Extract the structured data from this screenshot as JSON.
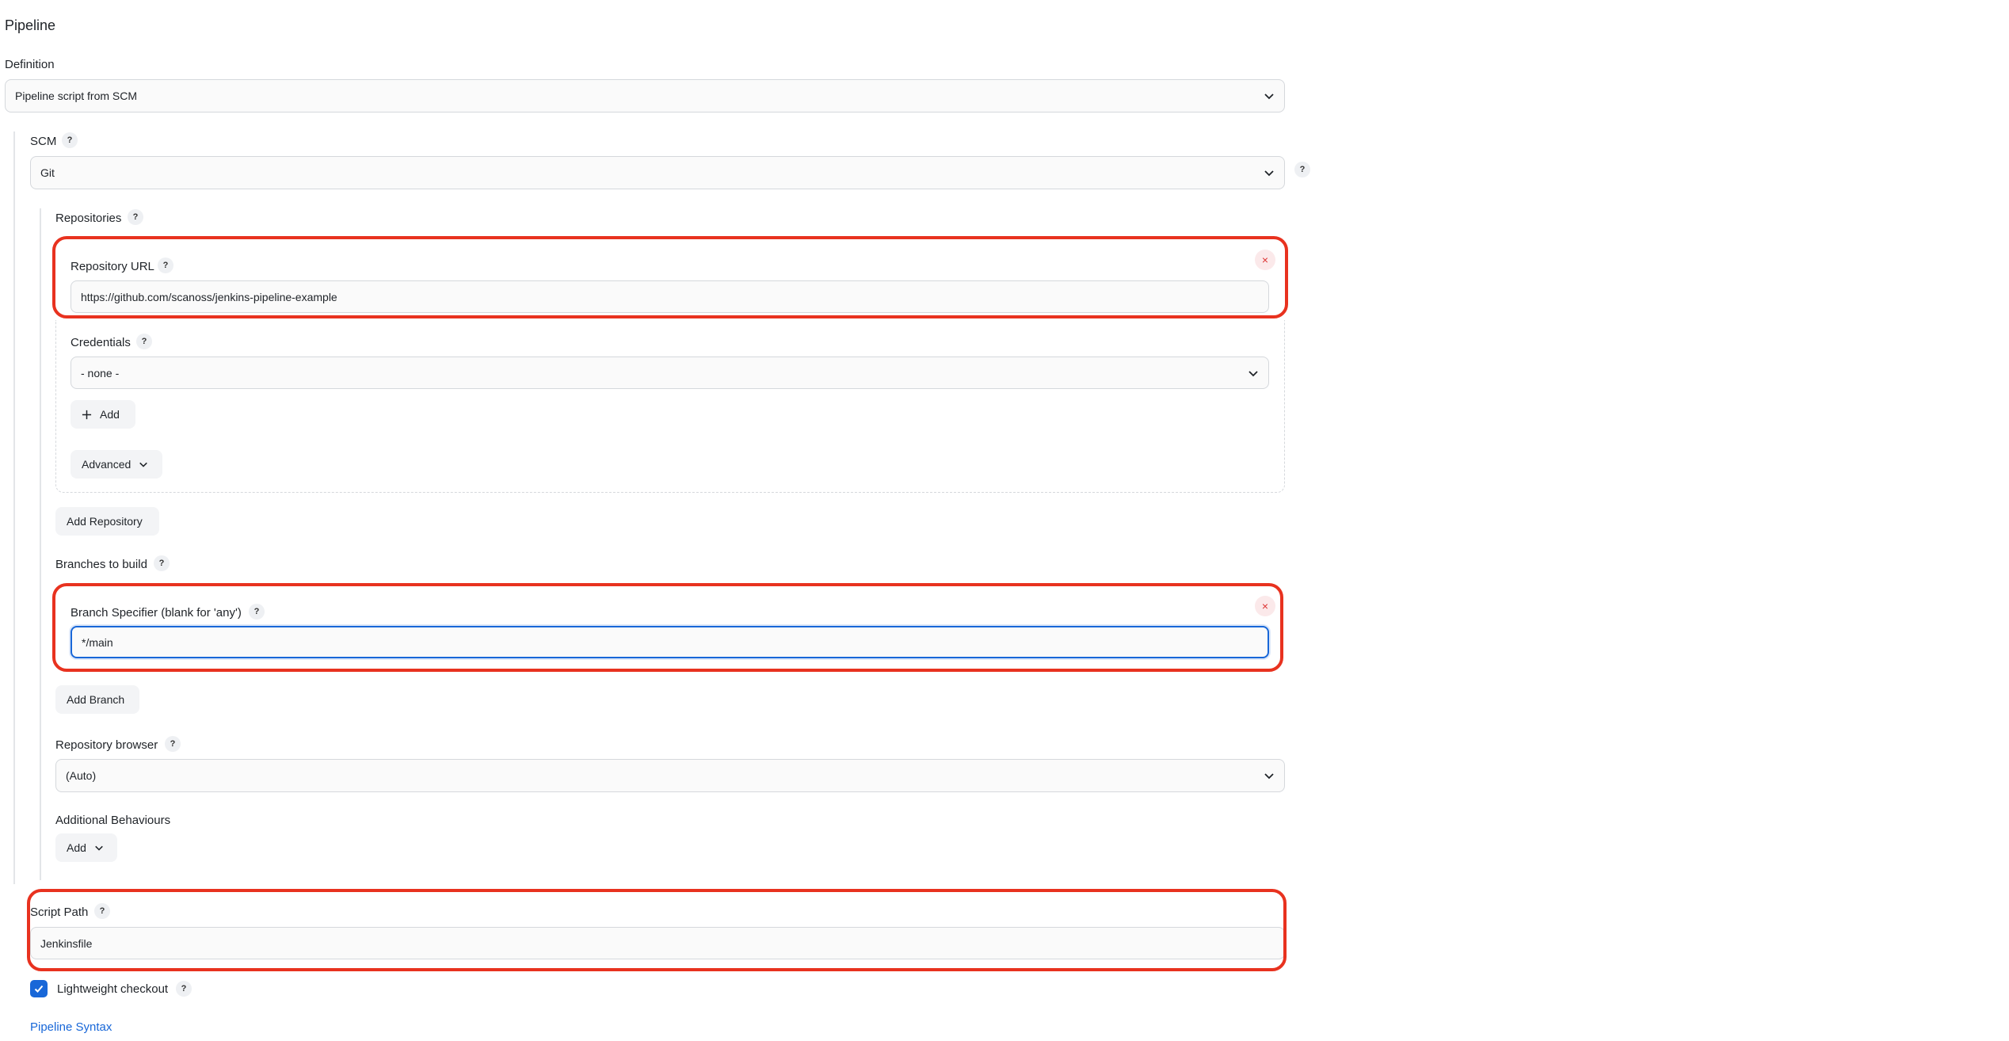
{
  "pipeline": {
    "section_title": "Pipeline",
    "definition_label": "Definition",
    "definition_value": "Pipeline script from SCM"
  },
  "scm": {
    "label": "SCM",
    "value": "Git",
    "repositories_label": "Repositories",
    "repository_url_label": "Repository URL",
    "repository_url_value": "https://github.com/scanoss/jenkins-pipeline-example",
    "credentials_label": "Credentials",
    "credentials_value": "- none -",
    "add_credentials_label": "Add",
    "advanced_label": "Advanced",
    "add_repository_label": "Add Repository",
    "branches_label": "Branches to build",
    "branch_specifier_label": "Branch Specifier (blank for 'any')",
    "branch_specifier_value": "*/main",
    "add_branch_label": "Add Branch",
    "repo_browser_label": "Repository browser",
    "repo_browser_value": "(Auto)",
    "additional_behaviours_label": "Additional Behaviours",
    "add_behaviour_label": "Add"
  },
  "script": {
    "label": "Script Path",
    "value": "Jenkinsfile",
    "lightweight_label": "Lightweight checkout",
    "lightweight_checked": true,
    "pipeline_syntax_link": "Pipeline Syntax"
  },
  "help_glyph": "?",
  "close_glyph": "×",
  "colors": {
    "highlight": "#e8321f",
    "accent": "#1867d8",
    "field_border": "#d5d8dc"
  }
}
